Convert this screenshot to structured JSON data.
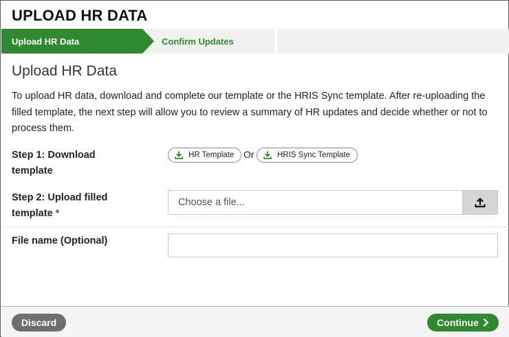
{
  "dialog": {
    "title": "UPLOAD HR DATA"
  },
  "steps": {
    "active": "Upload HR Data",
    "next": "Confirm Updates"
  },
  "section": {
    "heading": "Upload HR Data",
    "intro": "To upload HR data, download and complete our template or the HRIS Sync template. After re-uploading the filled template, the next step will allow you to review a summary of HR updates and decide whether or not to process them."
  },
  "step1": {
    "label_line1": "Step 1: Download",
    "label_line2": "template",
    "hr_template": "HR Template",
    "or": "Or",
    "hris_template": "HRIS Sync Template"
  },
  "step2": {
    "label_line1": "Step 2: Upload filled",
    "label_line2": "template",
    "required_mark": "*",
    "placeholder": "Choose a file..."
  },
  "file_name": {
    "label": "File name (Optional)",
    "value": ""
  },
  "footer": {
    "discard": "Discard",
    "continue": "Continue"
  },
  "colors": {
    "brand_green": "#2f8a2f",
    "discard_gray": "#6e6e6e"
  }
}
